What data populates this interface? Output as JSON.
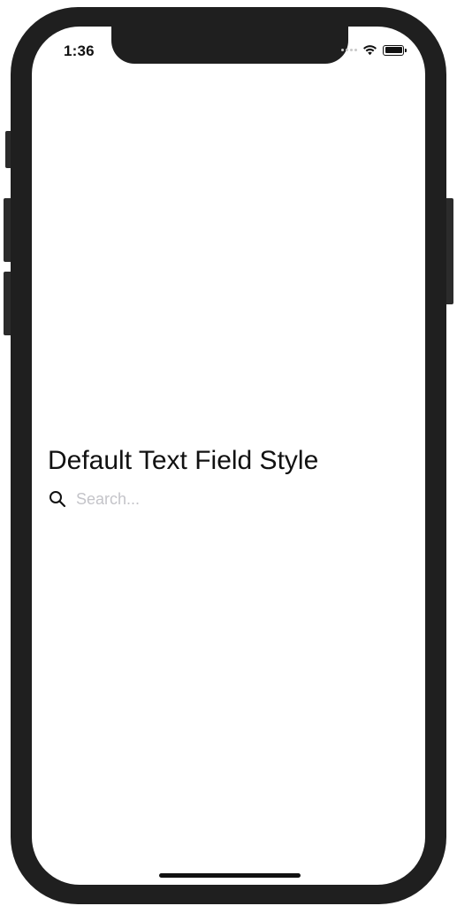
{
  "status_bar": {
    "time": "1:36",
    "icons": [
      "signal-dots-icon",
      "wifi-icon",
      "battery-icon"
    ]
  },
  "content": {
    "title": "Default Text Field Style",
    "search": {
      "icon": "magnifying-glass-icon",
      "placeholder": "Search...",
      "value": ""
    }
  },
  "colors": {
    "frame": "#1f1f1f",
    "screen": "#ffffff",
    "text": "#111111",
    "placeholder": "#c4c4c9"
  }
}
